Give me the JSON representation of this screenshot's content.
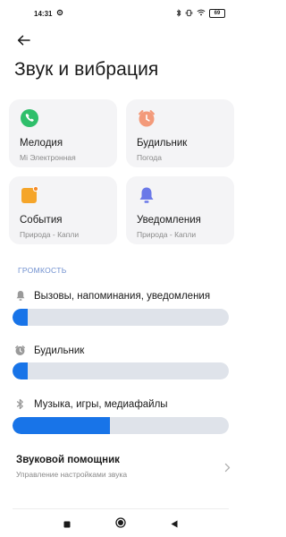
{
  "status_bar": {
    "time": "14:31",
    "battery": "69",
    "icons": [
      "gear-icon",
      "bluetooth-icon",
      "vibrate-icon",
      "wifi-icon",
      "battery-icon"
    ]
  },
  "header": {
    "back_icon": "arrow-left-icon",
    "title": "Звук и вибрация"
  },
  "cards": [
    {
      "title": "Мелодия",
      "subtitle": "Mi Электронная",
      "icon": "phone-icon",
      "color": "#2fbf6b"
    },
    {
      "title": "Будильник",
      "subtitle": "Погода",
      "icon": "alarm-clock-icon",
      "color": "#f39a7a"
    },
    {
      "title": "События",
      "subtitle": "Природа - Капли",
      "icon": "calendar-icon",
      "color": "#f5a52a"
    },
    {
      "title": "Уведомления",
      "subtitle": "Природа - Капли",
      "icon": "bell-icon",
      "color": "#6b79e8"
    }
  ],
  "volume": {
    "section_label": "ГРОМКОСТЬ",
    "sliders": [
      {
        "label": "Вызовы, напоминания, уведомления",
        "icon": "bell-icon",
        "level": 0.07
      },
      {
        "label": "Будильник",
        "icon": "alarm-clock-icon",
        "level": 0.07
      },
      {
        "label": "Музыка, игры, медиафайлы",
        "icon": "bluetooth-icon",
        "level": 0.45
      }
    ]
  },
  "assistant": {
    "title": "Звуковой помощник",
    "subtitle": "Управление настройками звука",
    "icon": "chevron-right-icon"
  },
  "colors": {
    "accent": "#1874e8",
    "slider_track": "#dfe3ea",
    "card_bg": "#f4f4f6",
    "section_label": "#6f8fcf"
  },
  "nav_bar": {
    "icons": [
      "square-icon",
      "circle-icon",
      "triangle-back-icon"
    ]
  }
}
